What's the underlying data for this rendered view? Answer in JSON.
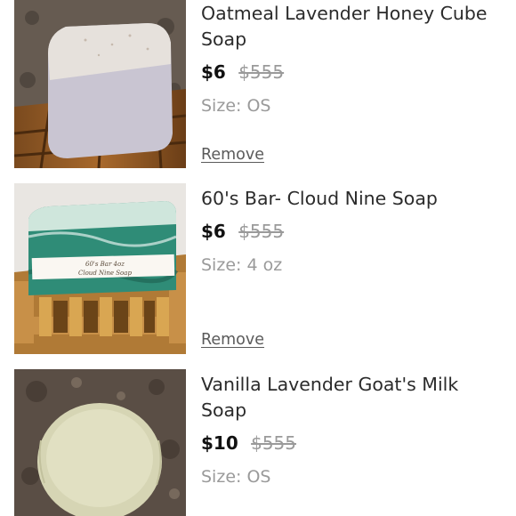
{
  "items": [
    {
      "title": "Oatmeal Lavender Honey Cube Soap",
      "price": "$6",
      "original_price": "$555",
      "size_label": "Size:",
      "size_value": "OS",
      "remove_label": "Remove"
    },
    {
      "title": "60's Bar- Cloud Nine Soap",
      "price": "$6",
      "original_price": "$555",
      "size_label": "Size:",
      "size_value": "4 oz",
      "remove_label": "Remove",
      "image_label_line1": "60's Bar  4oz",
      "image_label_line2": "Cloud Nine Soap"
    },
    {
      "title": "Vanilla Lavender Goat's Milk Soap",
      "price": "$10",
      "original_price": "$555",
      "size_label": "Size:",
      "size_value": "OS"
    }
  ]
}
